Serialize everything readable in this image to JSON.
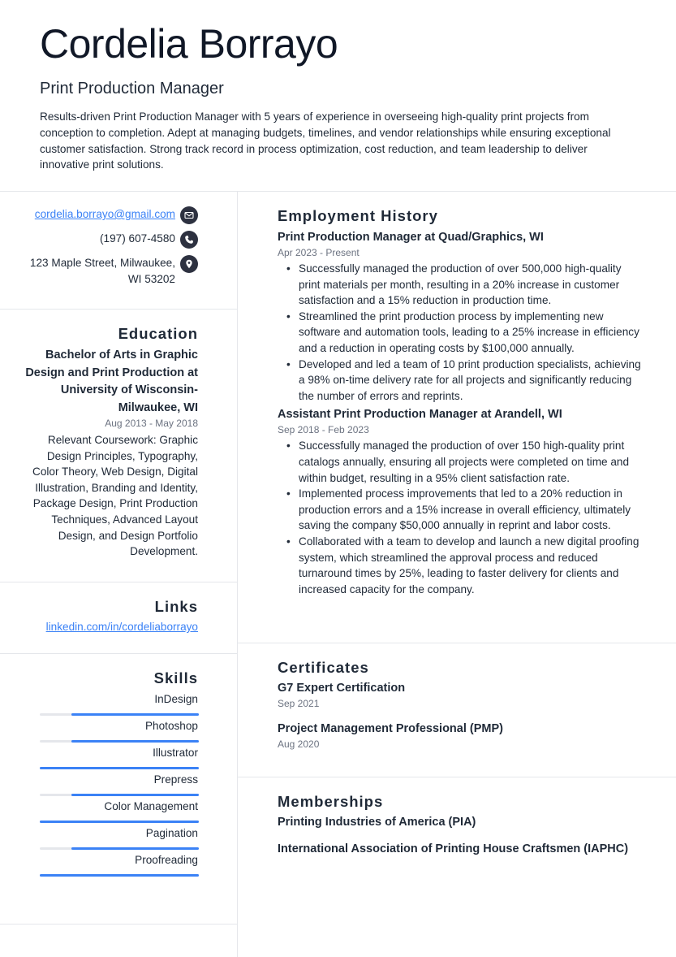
{
  "header": {
    "name": "Cordelia Borrayo",
    "title": "Print Production Manager",
    "summary": "Results-driven Print Production Manager with 5 years of experience in overseeing high-quality print projects from conception to completion. Adept at managing budgets, timelines, and vendor relationships while ensuring exceptional customer satisfaction. Strong track record in process optimization, cost reduction, and team leadership to deliver innovative print solutions."
  },
  "contact": {
    "email": "cordelia.borrayo@gmail.com",
    "email_icon": "envelope-icon",
    "phone": "(197) 607-4580",
    "phone_icon": "phone-icon",
    "address": "123 Maple Street, Milwaukee, WI 53202",
    "address_icon": "map-pin-icon"
  },
  "education": {
    "heading": "Education",
    "degree": "Bachelor of Arts in Graphic Design and Print Production at University of Wisconsin-Milwaukee, WI",
    "dates": "Aug 2013 - May 2018",
    "coursework": "Relevant Coursework: Graphic Design Principles, Typography, Color Theory, Web Design, Digital Illustration, Branding and Identity, Package Design, Print Production Techniques, Advanced Layout Design, and Design Portfolio Development."
  },
  "links": {
    "heading": "Links",
    "items": [
      "linkedin.com/in/cordeliaborrayo"
    ]
  },
  "skills": {
    "heading": "Skills",
    "accent": "#3b82f6",
    "items": [
      {
        "name": "InDesign",
        "level": 0.8
      },
      {
        "name": "Photoshop",
        "level": 0.8
      },
      {
        "name": "Illustrator",
        "level": 1.0
      },
      {
        "name": "Prepress",
        "level": 0.8
      },
      {
        "name": "Color Management",
        "level": 1.0
      },
      {
        "name": "Pagination",
        "level": 0.8
      },
      {
        "name": "Proofreading",
        "level": 1.0
      }
    ]
  },
  "employment": {
    "heading": "Employment History",
    "jobs": [
      {
        "title": "Print Production Manager at Quad/Graphics, WI",
        "dates": "Apr 2023 - Present",
        "bullets": [
          "Successfully managed the production of over 500,000 high-quality print materials per month, resulting in a 20% increase in customer satisfaction and a 15% reduction in production time.",
          "Streamlined the print production process by implementing new software and automation tools, leading to a 25% increase in efficiency and a reduction in operating costs by $100,000 annually.",
          "Developed and led a team of 10 print production specialists, achieving a 98% on-time delivery rate for all projects and significantly reducing the number of errors and reprints."
        ]
      },
      {
        "title": "Assistant Print Production Manager at Arandell, WI",
        "dates": "Sep 2018 - Feb 2023",
        "bullets": [
          "Successfully managed the production of over 150 high-quality print catalogs annually, ensuring all projects were completed on time and within budget, resulting in a 95% client satisfaction rate.",
          "Implemented process improvements that led to a 20% reduction in production errors and a 15% increase in overall efficiency, ultimately saving the company $50,000 annually in reprint and labor costs.",
          "Collaborated with a team to develop and launch a new digital proofing system, which streamlined the approval process and reduced turnaround times by 25%, leading to faster delivery for clients and increased capacity for the company."
        ]
      }
    ]
  },
  "certificates": {
    "heading": "Certificates",
    "items": [
      {
        "name": "G7 Expert Certification",
        "date": "Sep 2021"
      },
      {
        "name": "Project Management Professional (PMP)",
        "date": "Aug 2020"
      }
    ]
  },
  "memberships": {
    "heading": "Memberships",
    "items": [
      "Printing Industries of America (PIA)",
      "International Association of Printing House Craftsmen (IAPHC)"
    ]
  }
}
